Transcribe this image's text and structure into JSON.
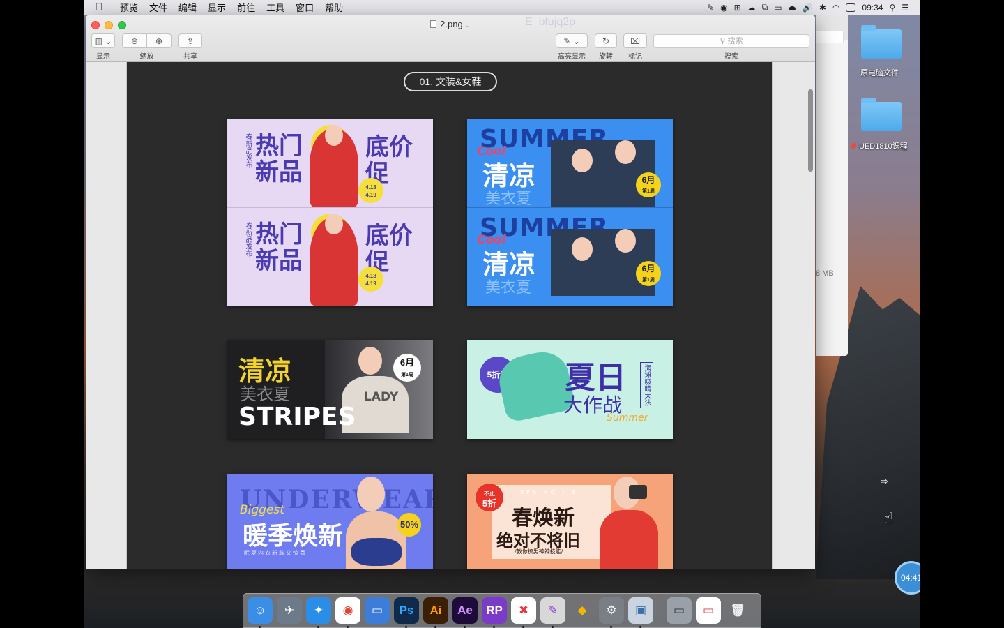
{
  "menubar": {
    "menus": [
      "预览",
      "文件",
      "编辑",
      "显示",
      "前往",
      "工具",
      "窗口",
      "帮助"
    ],
    "clock": "09:34"
  },
  "window": {
    "title": "2.png",
    "ghost_text": "E_bfujq2p",
    "toolbar": {
      "sidebar_label": "显示",
      "zoom_label": "缩放",
      "share_label": "共享",
      "highlight_label": "高亮显示",
      "rotate_label": "旋转",
      "markup_label": "标记",
      "search_label": "搜索",
      "search_placeholder": "搜索"
    }
  },
  "document": {
    "section_title": "01. 文装&女鞋",
    "banners": {
      "b1": {
        "line1": "热门",
        "line2": "新品",
        "right1": "底价",
        "right2": "促",
        "vertical": "春新品发布",
        "badge": "4.18\n4.19"
      },
      "b2": {
        "top": "SUMMER",
        "script": "Cool",
        "main": "清凉",
        "sub": "美衣夏",
        "badge": "6月",
        "badge_sub": "第1周"
      },
      "b3": {
        "main": "清凉",
        "sub": "美衣夏",
        "word": "STRIPES",
        "badge": "6月",
        "badge_sub": "第1周",
        "shirt": "LADY"
      },
      "b4": {
        "badge": "5折起",
        "main1": "夏日",
        "main2": "大作战",
        "vertical": "海滩吸睛大法",
        "script": "Summer"
      },
      "b5": {
        "top": "UNDERWEAR",
        "script": "Biggest",
        "main": "暖季焕新",
        "badge": "50%",
        "small": "眠夏内衣新款又惊喜"
      },
      "b6": {
        "badge": "5折",
        "badge_top": "不止",
        "top": "SPRING / S",
        "main1": "春焕新",
        "main2": "绝对不将旧",
        "small": "/教你撩男神神技能/"
      }
    }
  },
  "back_window": {
    "size_text": "8 MB"
  },
  "desktop": {
    "folders": [
      {
        "label": "原电脑文件"
      },
      {
        "label": "UED1810课程"
      }
    ],
    "timer": "04:41"
  },
  "dock": {
    "items": [
      {
        "name": "finder-icon",
        "glyph": "☺",
        "bg": "#3a8ee6",
        "color": "#fff"
      },
      {
        "name": "launchpad-icon",
        "glyph": "✈",
        "bg": "#6c7a89",
        "color": "#fff"
      },
      {
        "name": "safari-icon",
        "glyph": "✦",
        "bg": "#2a8de8",
        "color": "#fff"
      },
      {
        "name": "chrome-icon",
        "glyph": "◉",
        "bg": "#ffffff",
        "color": "#e34234"
      },
      {
        "name": "keynote-icon",
        "glyph": "▭",
        "bg": "#3b7dd8",
        "color": "#fff"
      },
      {
        "name": "photoshop-icon",
        "glyph": "Ps",
        "bg": "#0f2a4a",
        "color": "#31a8ff"
      },
      {
        "name": "illustrator-icon",
        "glyph": "Ai",
        "bg": "#3a1f05",
        "color": "#ff9a00"
      },
      {
        "name": "after-effects-icon",
        "glyph": "Ae",
        "bg": "#1d0b3a",
        "color": "#d291ff"
      },
      {
        "name": "axure-rp-icon",
        "glyph": "RP",
        "bg": "#7a3cc8",
        "color": "#fff"
      },
      {
        "name": "xmind-icon",
        "glyph": "✖",
        "bg": "#ffffff",
        "color": "#e8373d"
      },
      {
        "name": "usb-tool-icon",
        "glyph": "✎",
        "bg": "#d8d8d8",
        "color": "#8a3ad0"
      },
      {
        "name": "sketch-icon",
        "glyph": "◆",
        "bg": "transparent",
        "color": "#f7b500"
      },
      {
        "name": "system-preferences-icon",
        "glyph": "⚙",
        "bg": "#7a7f86",
        "color": "#fff"
      },
      {
        "name": "preview-icon",
        "glyph": "▣",
        "bg": "#c9d4e0",
        "color": "#3d6ea8"
      },
      {
        "name": "ps-document-icon",
        "glyph": "▭",
        "bg": "#9aa0a8",
        "color": "#333"
      },
      {
        "name": "xmind-document-icon",
        "glyph": "▭",
        "bg": "#ffffff",
        "color": "#e8373d"
      },
      {
        "name": "trash-icon",
        "glyph": "🗑",
        "bg": "transparent",
        "color": "#eee"
      }
    ]
  },
  "colors": {
    "canvas_bg": "#2b2b2b",
    "accent_blue": "#3b8fd6"
  }
}
